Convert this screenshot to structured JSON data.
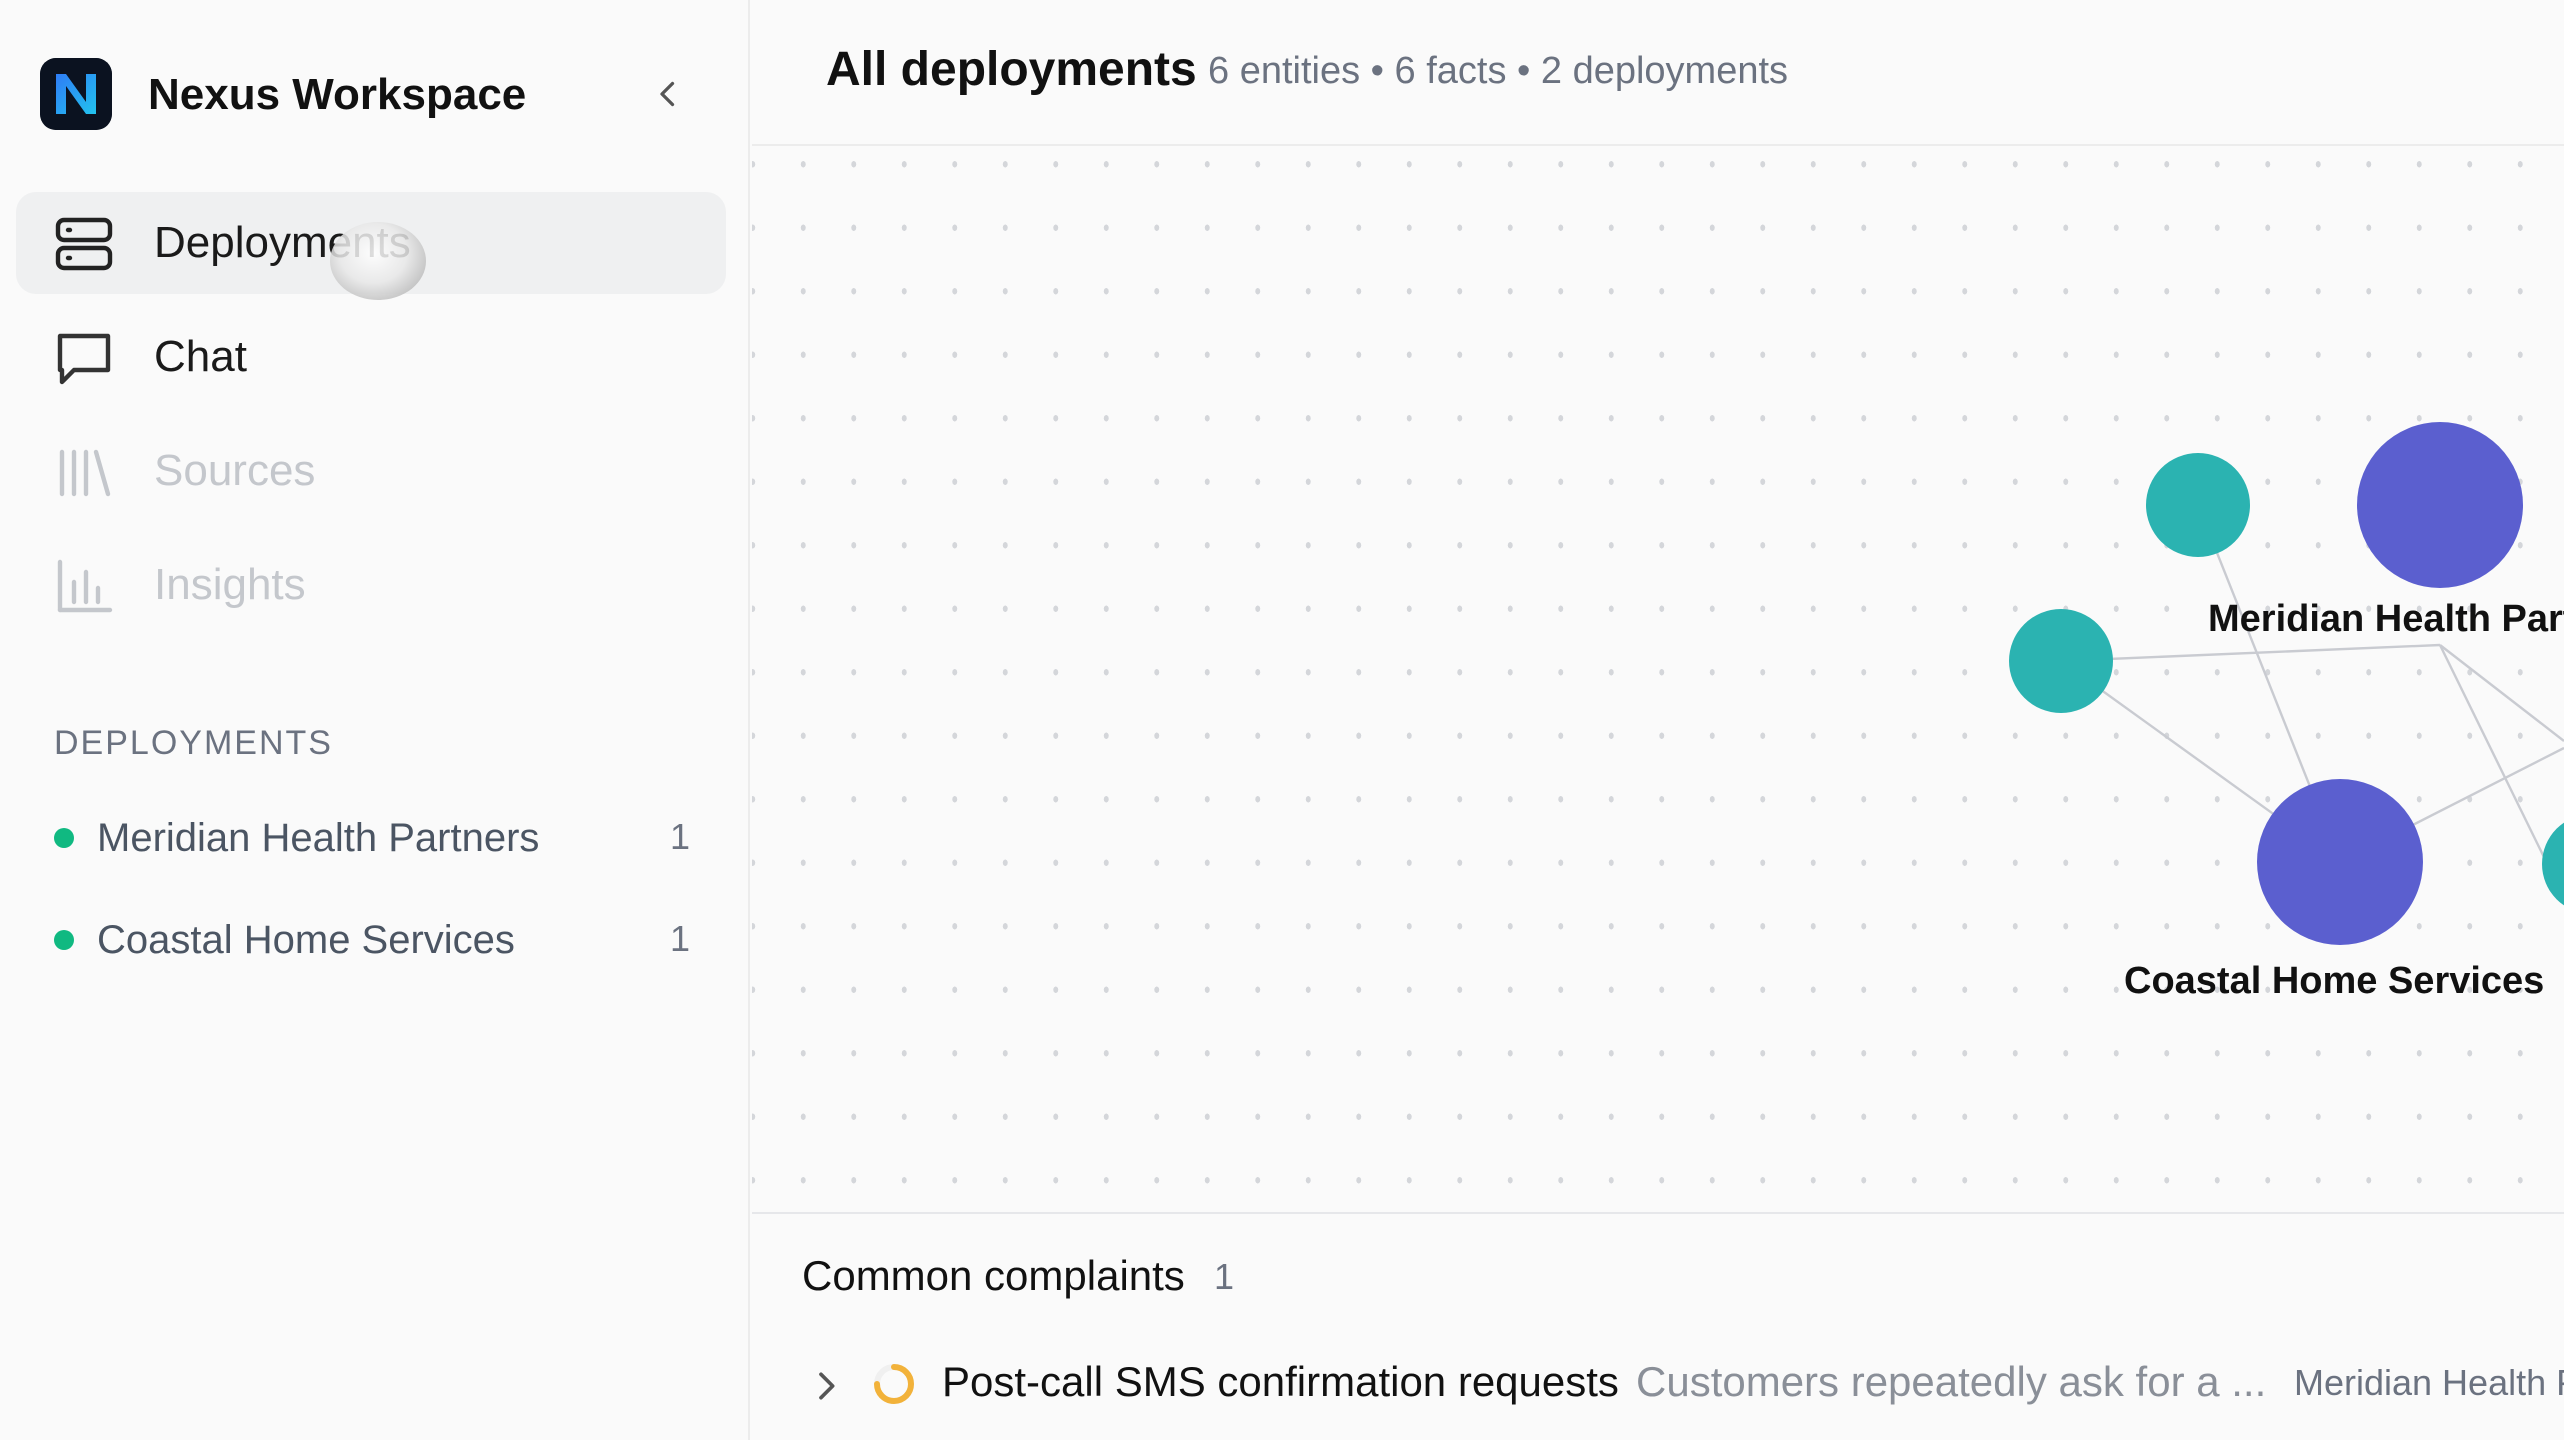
{
  "workspace": {
    "name": "Nexus Workspace",
    "logo_letter": "N"
  },
  "nav": {
    "items": [
      {
        "label": "Deployments",
        "icon": "server-stack-icon",
        "state": "active"
      },
      {
        "label": "Chat",
        "icon": "chat-bubble-icon",
        "state": "normal"
      },
      {
        "label": "Sources",
        "icon": "library-icon",
        "state": "disabled"
      },
      {
        "label": "Insights",
        "icon": "bar-chart-icon",
        "state": "disabled"
      }
    ]
  },
  "deployments_section": {
    "title": "DEPLOYMENTS",
    "items": [
      {
        "label": "Meridian Health Partners",
        "count": "1",
        "status_color": "#10b981"
      },
      {
        "label": "Coastal Home Services",
        "count": "1",
        "status_color": "#10b981"
      }
    ]
  },
  "header": {
    "title": "All deployments",
    "stats": "6 entities • 6 facts • 2 deployments"
  },
  "graph": {
    "node_colors": {
      "deployment": "#5b5fcf",
      "entity": "#2bb3b1",
      "edge": "#c9cbd1"
    },
    "labels": {
      "meridian": "Meridian Health Partners",
      "coastal": "Coastal Home Services"
    }
  },
  "complaints": {
    "title": "Common complaints",
    "count": "1",
    "rows": [
      {
        "title": "Post-call SMS confirmation requests",
        "description": "Customers repeatedly ask for a ...",
        "deployment": "Meridian Health Partners"
      }
    ]
  }
}
